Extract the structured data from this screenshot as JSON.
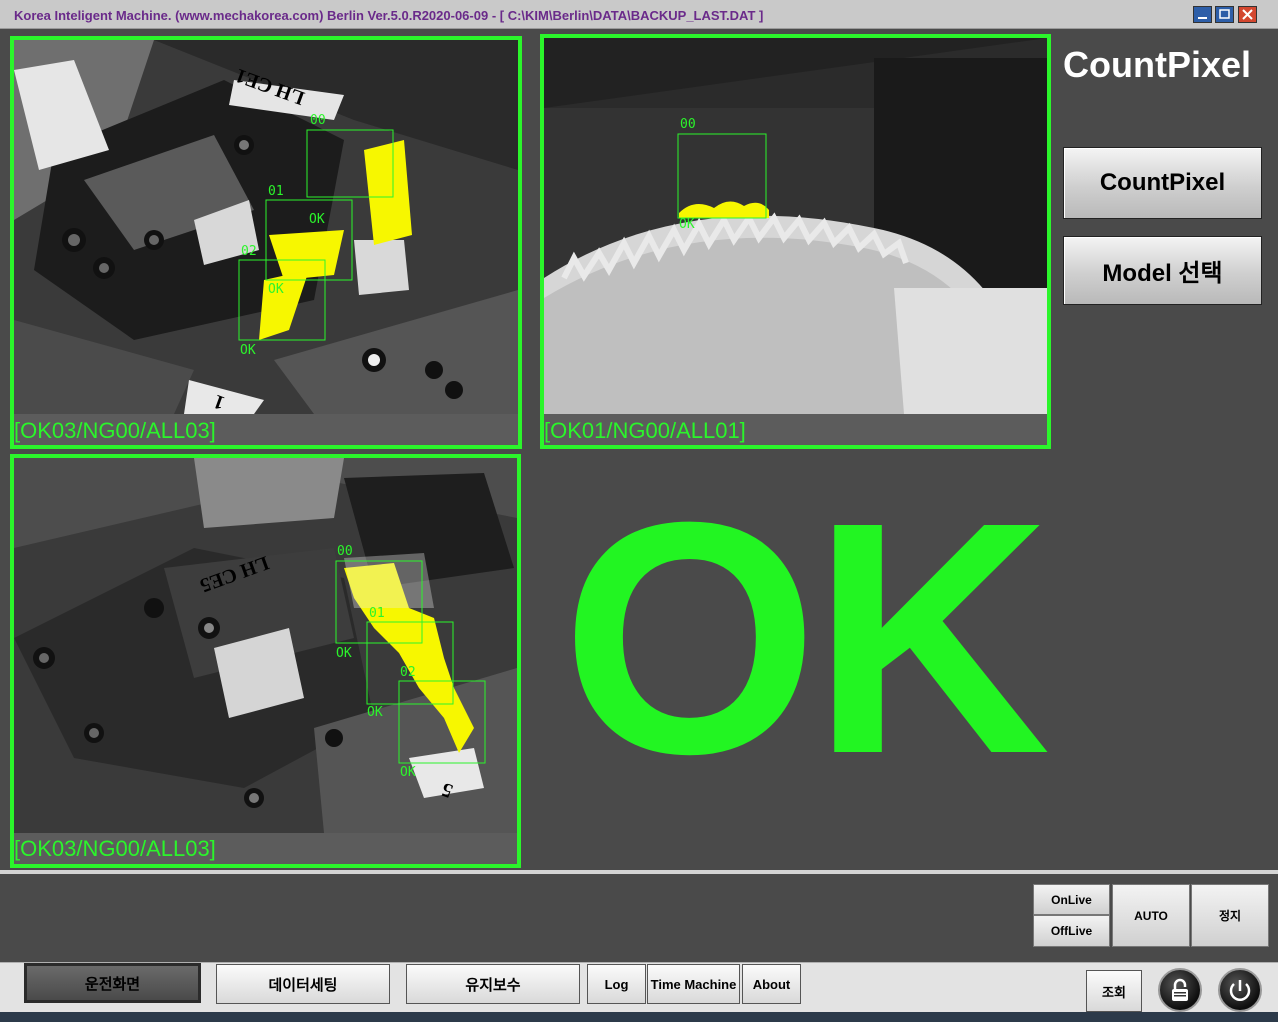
{
  "window": {
    "title": "Korea Inteligent Machine. (www.mechakorea.com) Berlin Ver.5.0.R2020-06-09 - [ C:\\KIM\\Berlin\\DATA\\BACKUP_LAST.DAT ]"
  },
  "cameras": [
    {
      "status": "[OK03/NG00/ALL03]",
      "label": "LH CE1",
      "tag": "1",
      "rois": [
        {
          "id": "00",
          "result": "OK"
        },
        {
          "id": "01",
          "result": "OK"
        },
        {
          "id": "02",
          "result": "OK"
        }
      ]
    },
    {
      "status": "[OK01/NG00/ALL01]",
      "rois": [
        {
          "id": "00",
          "result": "OK"
        }
      ]
    },
    {
      "status": "[OK03/NG00/ALL03]",
      "label": "LH CE5",
      "tag": "5",
      "rois": [
        {
          "id": "00",
          "result": "OK"
        },
        {
          "id": "01",
          "result": "OK"
        },
        {
          "id": "02",
          "result": "OK"
        }
      ]
    }
  ],
  "side": {
    "app_title": "CountPixel",
    "countpixel_button": "CountPixel",
    "model_button": "Model 선택"
  },
  "result": {
    "text": "OK",
    "color": "#22f522"
  },
  "controls": {
    "online": "OnLive",
    "offline": "OffLive",
    "auto": "AUTO",
    "stop": "정지"
  },
  "nav": {
    "run_screen": "운전화면",
    "data_setting": "데이터세팅",
    "maintenance": "유지보수",
    "log": "Log",
    "time_machine": "Time Machine",
    "about": "About",
    "query": "조회"
  },
  "icons": {
    "lock": "lock-icon",
    "power": "power-icon"
  },
  "colors": {
    "accent_green": "#2bf52b",
    "roi_yellow": "#f7f700",
    "background": "#4a4a4a"
  }
}
